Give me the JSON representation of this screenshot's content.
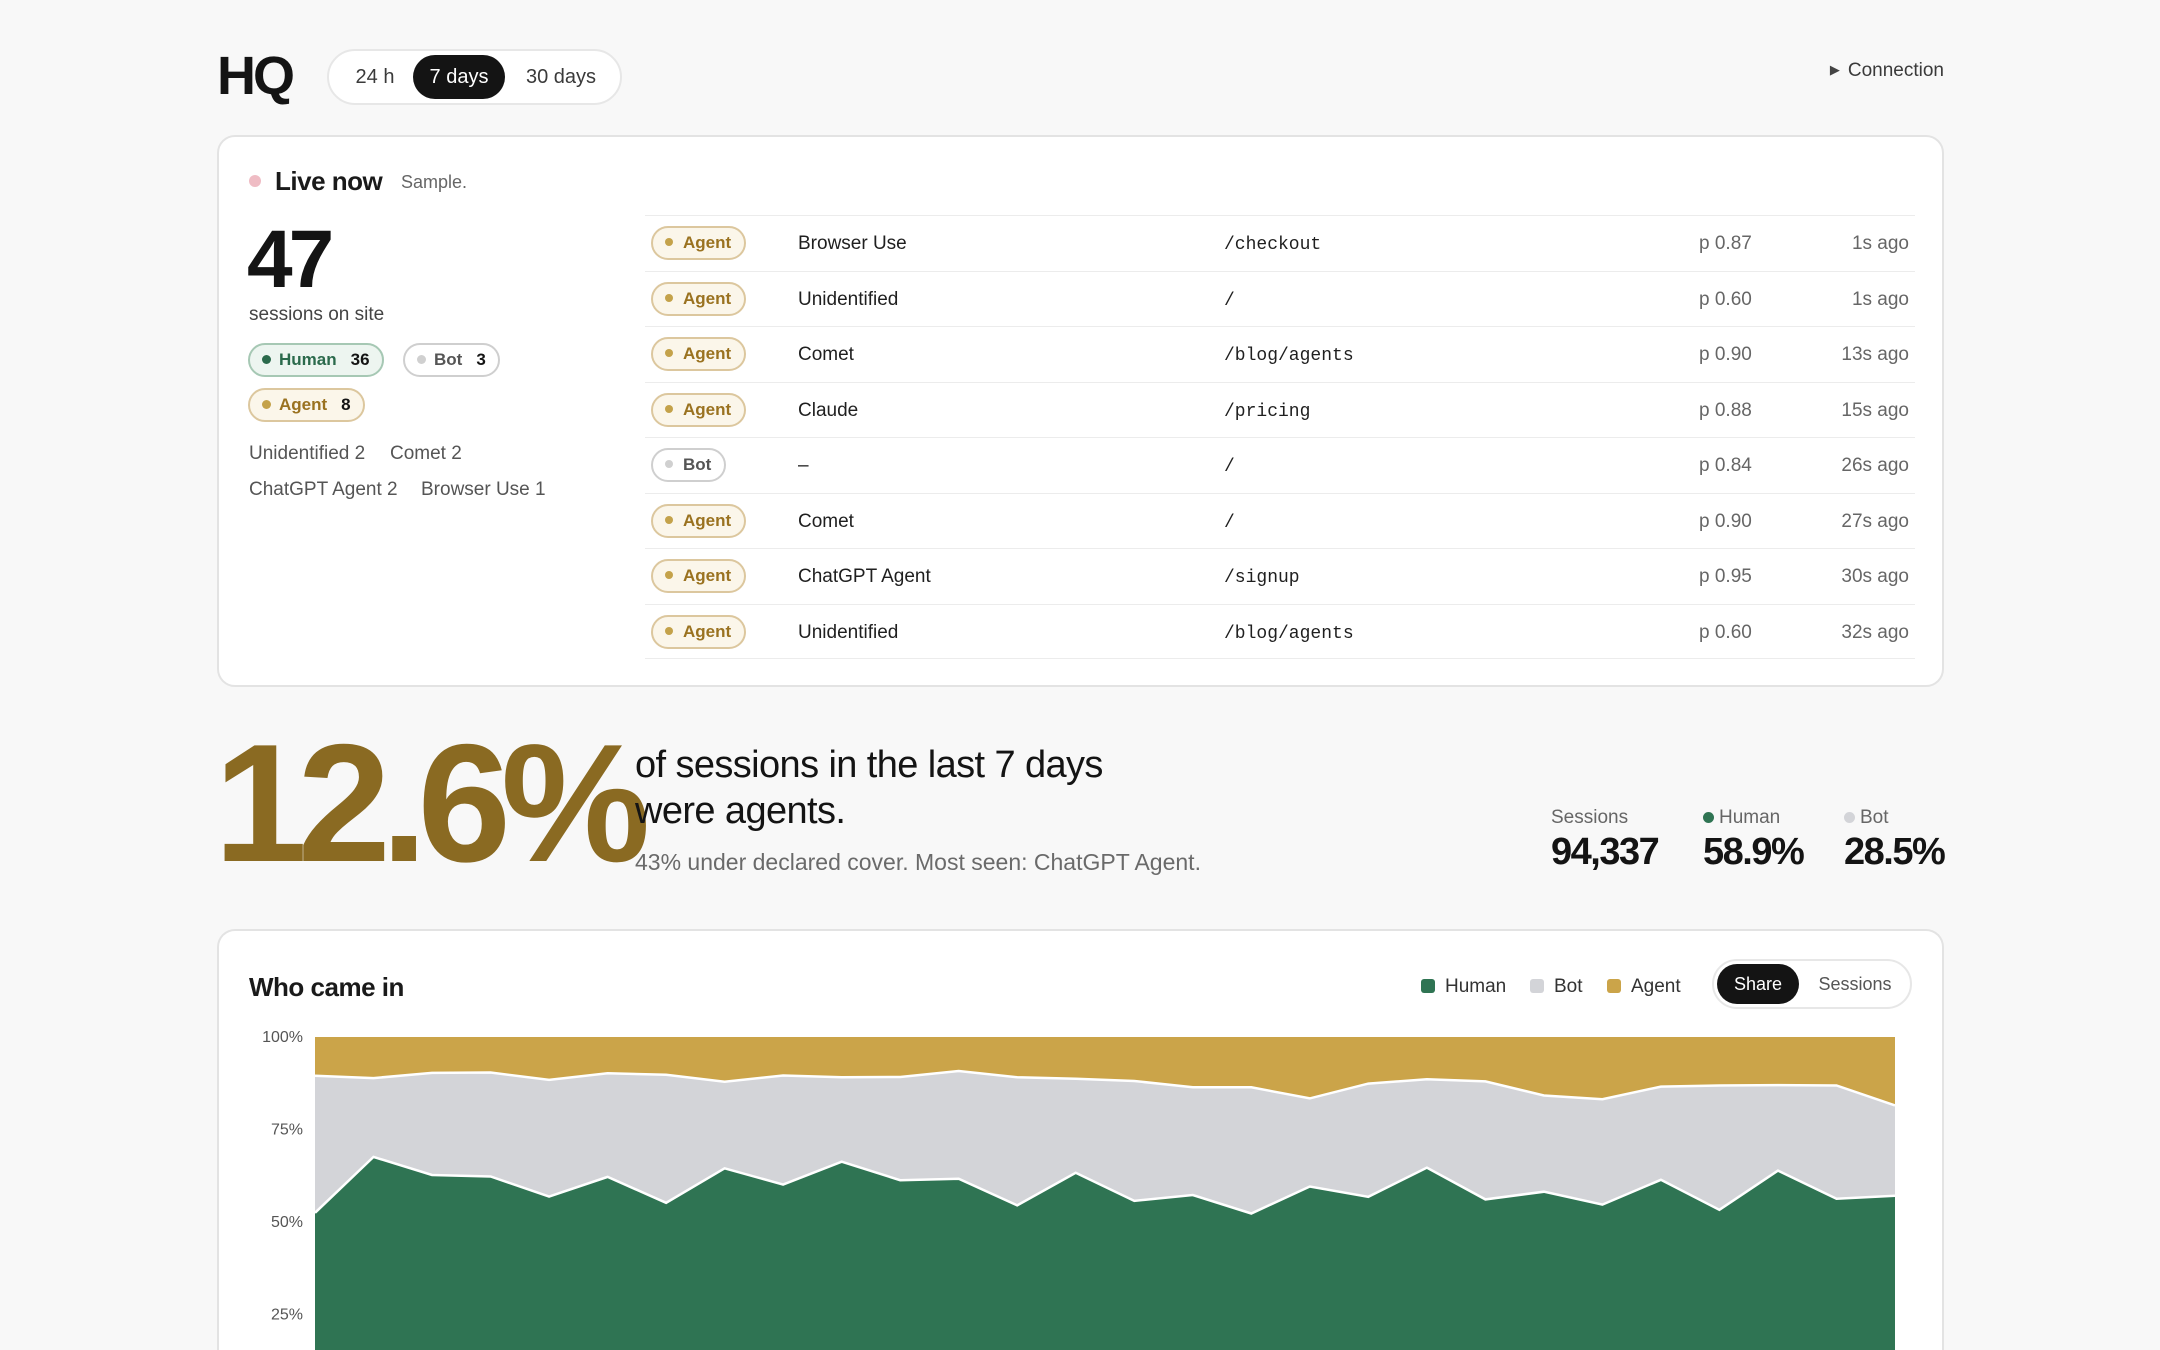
{
  "header": {
    "logo": "HQ",
    "ranges": [
      "24 h",
      "7 days",
      "30 days"
    ],
    "active_range": "7 days",
    "connection_label": "Connection"
  },
  "live": {
    "title": "Live now",
    "note": "Sample.",
    "count": "47",
    "count_label": "sessions on site",
    "pills": {
      "human": {
        "label": "Human",
        "count": "36"
      },
      "bot": {
        "label": "Bot",
        "count": "3"
      },
      "agent": {
        "label": "Agent",
        "count": "8"
      }
    },
    "breakdown": [
      "Unidentified 2",
      "Comet 2",
      "ChatGPT Agent 2",
      "Browser Use 1"
    ],
    "rows": [
      {
        "type": "Agent",
        "name": "Browser Use",
        "path": "/checkout",
        "prob": "p 0.87",
        "ago": "1s ago"
      },
      {
        "type": "Agent",
        "name": "Unidentified",
        "path": "/",
        "prob": "p 0.60",
        "ago": "1s ago"
      },
      {
        "type": "Agent",
        "name": "Comet",
        "path": "/blog/agents",
        "prob": "p 0.90",
        "ago": "13s ago"
      },
      {
        "type": "Agent",
        "name": "Claude",
        "path": "/pricing",
        "prob": "p 0.88",
        "ago": "15s ago"
      },
      {
        "type": "Bot",
        "name": "–",
        "path": "/",
        "prob": "p 0.84",
        "ago": "26s ago"
      },
      {
        "type": "Agent",
        "name": "Comet",
        "path": "/",
        "prob": "p 0.90",
        "ago": "27s ago"
      },
      {
        "type": "Agent",
        "name": "ChatGPT Agent",
        "path": "/signup",
        "prob": "p 0.95",
        "ago": "30s ago"
      },
      {
        "type": "Agent",
        "name": "Unidentified",
        "path": "/blog/agents",
        "prob": "p 0.60",
        "ago": "32s ago"
      }
    ]
  },
  "headline": {
    "value": "12.6%",
    "text_line1": "of sessions in the last 7 days",
    "text_line2": "were agents.",
    "sub": "43% under declared cover. Most seen: ChatGPT Agent."
  },
  "stats": {
    "sessions": {
      "label": "Sessions",
      "value": "94,337"
    },
    "human": {
      "label": "Human",
      "value": "58.9%"
    },
    "bot": {
      "label": "Bot",
      "value": "28.5%"
    }
  },
  "colors": {
    "human": "#2f7453",
    "bot": "#d3d4d8",
    "agent": "#cba449",
    "agent_text": "#8a6a22"
  },
  "chart_card": {
    "title": "Who came in",
    "legend": [
      "Human",
      "Bot",
      "Agent"
    ],
    "modes": [
      "Share",
      "Sessions"
    ],
    "active_mode": "Share"
  },
  "chart_data": {
    "type": "area",
    "title": "Who came in",
    "stacked": true,
    "y_tick_labels": [
      "100%",
      "75%",
      "50%",
      "25%"
    ],
    "ylim": [
      0,
      100
    ],
    "series": [
      {
        "name": "Human",
        "values": [
          52.5,
          67.6,
          62.7,
          62.3,
          56.9,
          62.2,
          55.2,
          64.5,
          60.1,
          66.3,
          61.3,
          61.7,
          54.5,
          63.3,
          55.7,
          57.3,
          52.3,
          59.6,
          56.8,
          64.7,
          56.1,
          58.2,
          54.7,
          61.4,
          53.3,
          63.9,
          56.3,
          57.1
        ],
        "cumulative_top": [
          52.5,
          67.6,
          62.7,
          62.3,
          56.9,
          62.2,
          55.2,
          64.5,
          60.1,
          66.3,
          61.3,
          61.7,
          54.5,
          63.3,
          55.7,
          57.3,
          52.3,
          59.6,
          56.8,
          64.7,
          56.1,
          58.2,
          54.7,
          61.4,
          53.3,
          63.9,
          56.3,
          57.1
        ]
      },
      {
        "name": "Bot",
        "cumulative_top": [
          89.5,
          88.9,
          90.3,
          90.4,
          88.4,
          90.2,
          89.8,
          87.9,
          89.6,
          89.1,
          89.2,
          90.8,
          89.1,
          88.7,
          88.1,
          86.4,
          86.4,
          83.4,
          87.4,
          88.6,
          88.0,
          84.2,
          83.2,
          86.6,
          86.9,
          87.0,
          86.9,
          81.5
        ]
      },
      {
        "name": "Agent",
        "cumulative_top": [
          100,
          100,
          100,
          100,
          100,
          100,
          100,
          100,
          100,
          100,
          100,
          100,
          100,
          100,
          100,
          100,
          100,
          100,
          100,
          100,
          100,
          100,
          100,
          100,
          100,
          100,
          100,
          100
        ]
      }
    ]
  }
}
